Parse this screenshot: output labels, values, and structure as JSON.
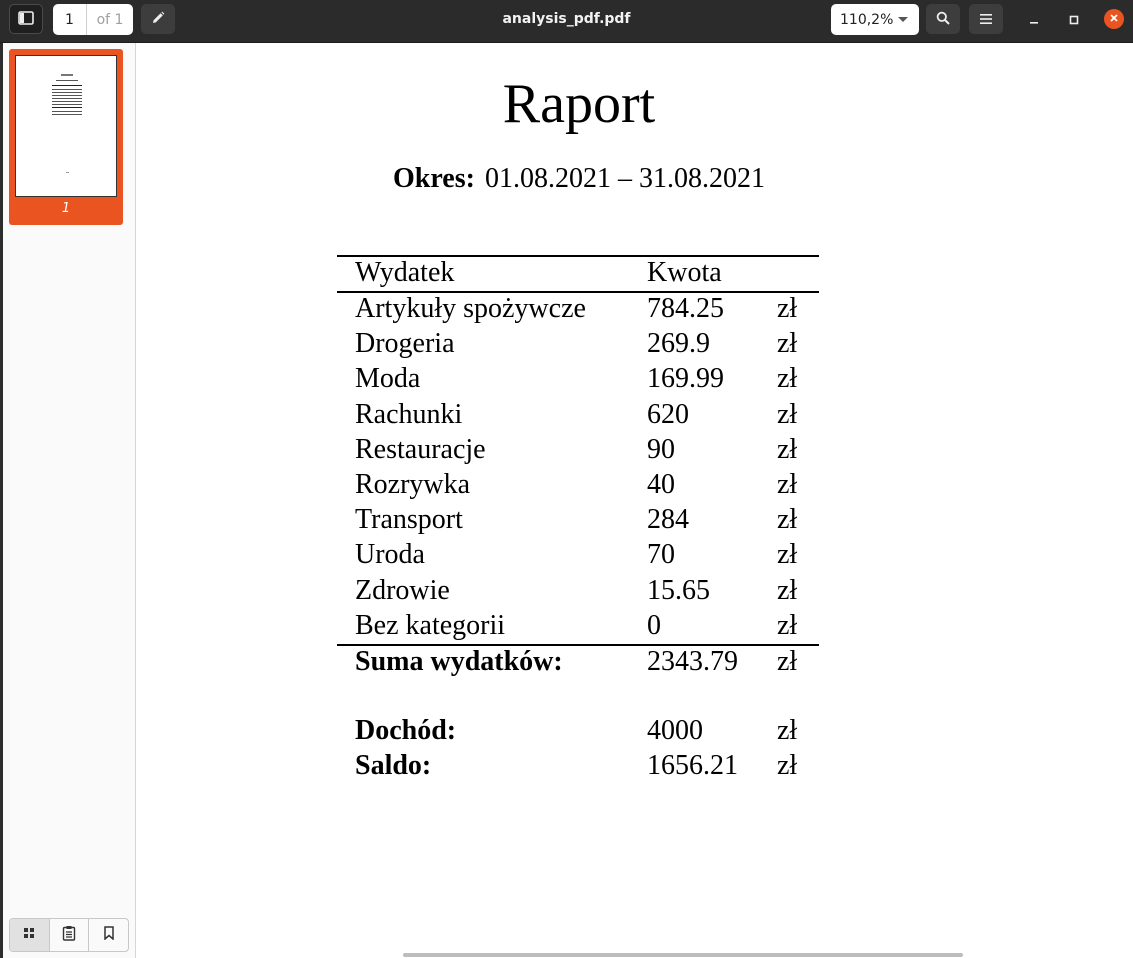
{
  "header": {
    "title": "analysis_pdf.pdf",
    "page_current": "1",
    "page_total": "of 1",
    "zoom": "110,2%",
    "sidebar_toggle_icon": "sidebar-icon",
    "annotate_icon": "pencil-icon",
    "search_icon": "search-icon",
    "menu_icon": "hamburger-menu-icon"
  },
  "sidebar": {
    "thumbnail_label": "1",
    "tabs": [
      "thumbnails",
      "annotations",
      "bookmarks"
    ]
  },
  "document": {
    "title": "Raport",
    "period_label": "Okres:",
    "period_value": "01.08.2021 – 31.08.2021",
    "headers": {
      "name": "Wydatek",
      "amount": "Kwota"
    },
    "rows": [
      {
        "name": "Artykuły spożywcze",
        "amount": "784.25",
        "currency": "zł"
      },
      {
        "name": "Drogeria",
        "amount": "269.9",
        "currency": "zł"
      },
      {
        "name": "Moda",
        "amount": "169.99",
        "currency": "zł"
      },
      {
        "name": "Rachunki",
        "amount": "620",
        "currency": "zł"
      },
      {
        "name": "Restauracje",
        "amount": "90",
        "currency": "zł"
      },
      {
        "name": "Rozrywka",
        "amount": "40",
        "currency": "zł"
      },
      {
        "name": "Transport",
        "amount": "284",
        "currency": "zł"
      },
      {
        "name": "Uroda",
        "amount": "70",
        "currency": "zł"
      },
      {
        "name": "Zdrowie",
        "amount": "15.65",
        "currency": "zł"
      },
      {
        "name": "Bez kategorii",
        "amount": "0",
        "currency": "zł"
      }
    ],
    "total": {
      "name": "Suma wydatków:",
      "amount": "2343.79",
      "currency": "zł"
    },
    "income": {
      "name": "Dochód:",
      "amount": "4000",
      "currency": "zł"
    },
    "balance": {
      "name": "Saldo:",
      "amount": "1656.21",
      "currency": "zł"
    }
  },
  "colors": {
    "accent": "#e95420",
    "headerbar": "#2b2b2b"
  }
}
